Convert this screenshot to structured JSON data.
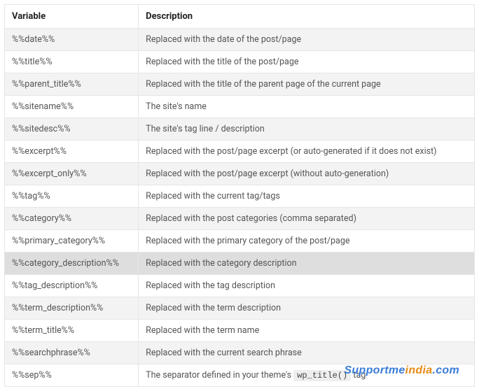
{
  "table": {
    "headers": {
      "variable": "Variable",
      "description": "Description"
    },
    "rows": [
      {
        "variable": "%%date%%",
        "description": "Replaced with the date of the post/page"
      },
      {
        "variable": "%%title%%",
        "description": "Replaced with the title of the post/page"
      },
      {
        "variable": "%%parent_title%%",
        "description": "Replaced with the title of the parent page of the current page"
      },
      {
        "variable": "%%sitename%%",
        "description": "The site's name"
      },
      {
        "variable": "%%sitedesc%%",
        "description": "The site's tag line / description"
      },
      {
        "variable": "%%excerpt%%",
        "description": "Replaced with the post/page excerpt (or auto-generated if it does not exist)"
      },
      {
        "variable": "%%excerpt_only%%",
        "description": "Replaced with the post/page excerpt (without auto-generation)"
      },
      {
        "variable": "%%tag%%",
        "description": "Replaced with the current tag/tags"
      },
      {
        "variable": "%%category%%",
        "description": "Replaced with the post categories (comma separated)"
      },
      {
        "variable": "%%primary_category%%",
        "description": "Replaced with the primary category of the post/page"
      },
      {
        "variable": "%%category_description%%",
        "description": "Replaced with the category description",
        "highlight": true
      },
      {
        "variable": "%%tag_description%%",
        "description": "Replaced with the tag description"
      },
      {
        "variable": "%%term_description%%",
        "description": "Replaced with the term description"
      },
      {
        "variable": "%%term_title%%",
        "description": "Replaced with the term name"
      },
      {
        "variable": "%%searchphrase%%",
        "description": "Replaced with the current search phrase"
      },
      {
        "variable": "%%sep%%",
        "description_prefix": "The separator defined in your theme's ",
        "code": "wp_title()",
        "description_suffix": " tag"
      }
    ]
  },
  "watermark": {
    "part1": "Supportme",
    "part2": "india",
    "part3": ".com"
  }
}
